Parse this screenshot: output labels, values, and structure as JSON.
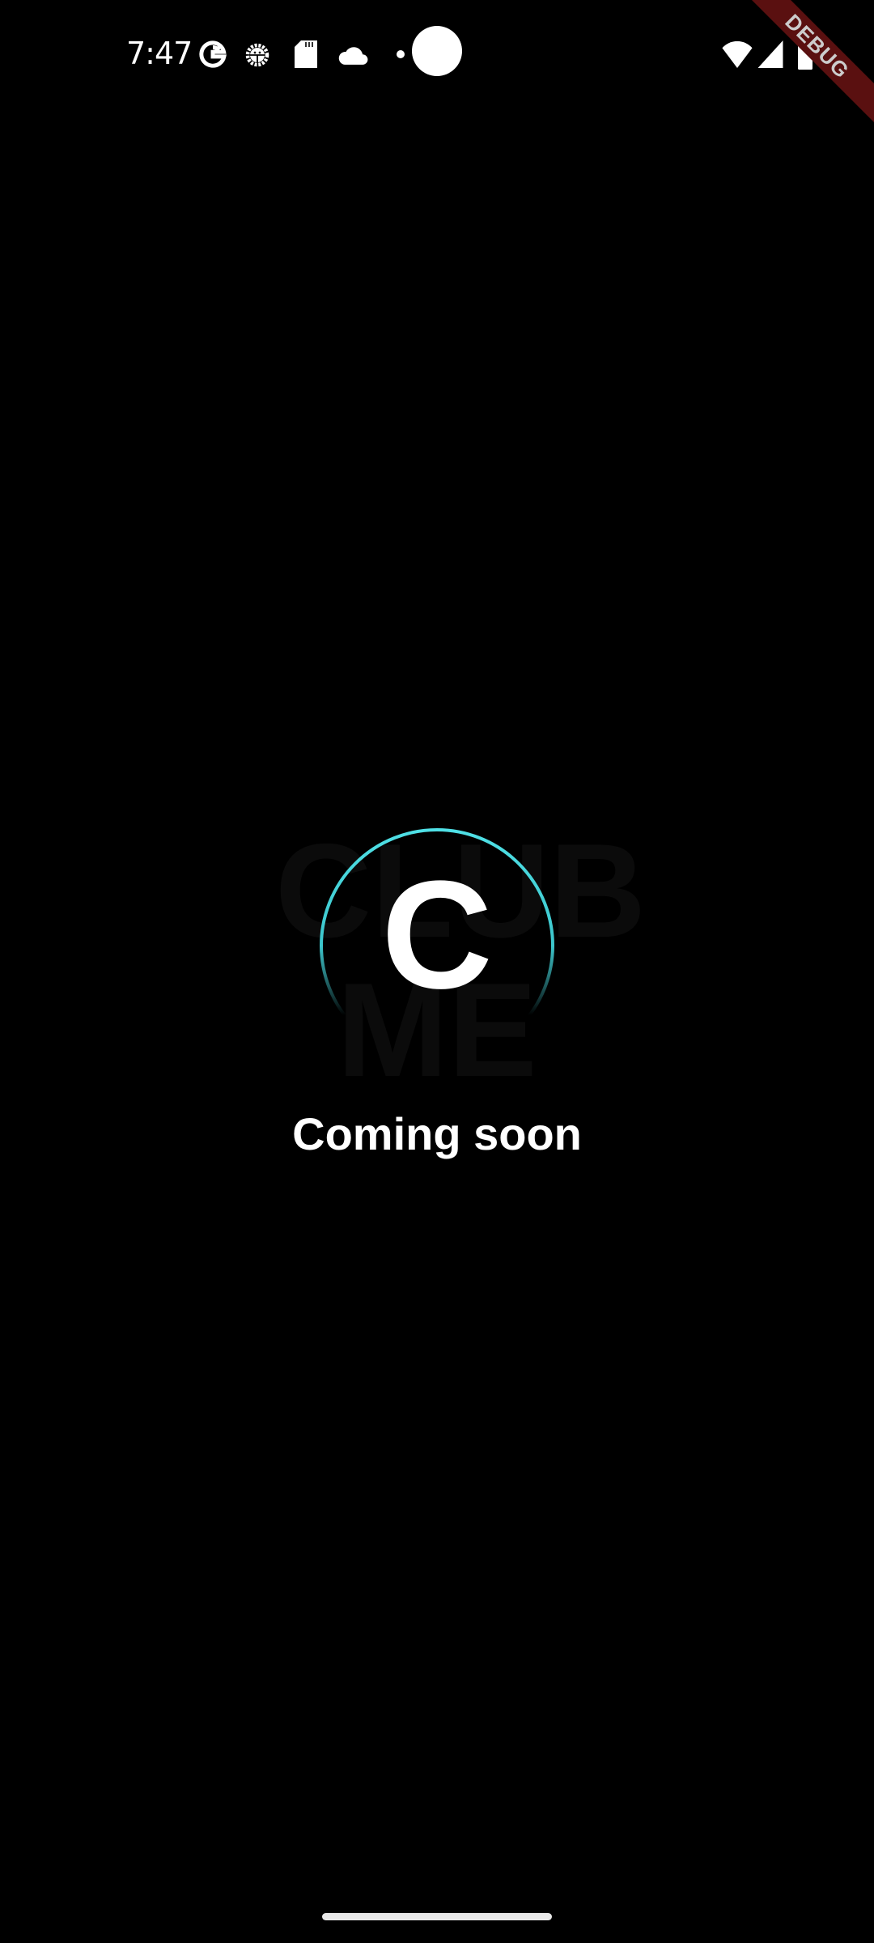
{
  "status_bar": {
    "time": "7:47",
    "left_icons": [
      "google-icon",
      "android-debug-icon",
      "sd-card-icon",
      "cloud-icon"
    ],
    "right_icons": [
      "wifi-icon",
      "signal-icon",
      "battery-icon"
    ]
  },
  "debug_banner": "DEBUG",
  "logo": {
    "watermark_line1": "CLUB",
    "watermark_line2": "ME",
    "letter": "C",
    "ring_color": "#4fe0e6"
  },
  "message": "Coming soon"
}
